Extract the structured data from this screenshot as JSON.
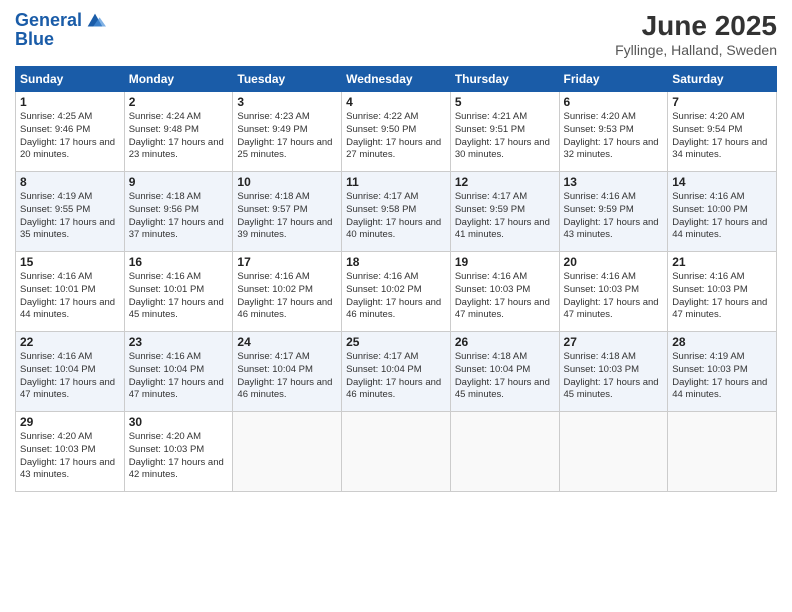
{
  "logo": {
    "line1": "General",
    "line2": "Blue"
  },
  "title": "June 2025",
  "location": "Fyllinge, Halland, Sweden",
  "days_of_week": [
    "Sunday",
    "Monday",
    "Tuesday",
    "Wednesday",
    "Thursday",
    "Friday",
    "Saturday"
  ],
  "weeks": [
    [
      {
        "day": 1,
        "sunrise": "4:25 AM",
        "sunset": "9:46 PM",
        "daylight": "17 hours and 20 minutes."
      },
      {
        "day": 2,
        "sunrise": "4:24 AM",
        "sunset": "9:48 PM",
        "daylight": "17 hours and 23 minutes."
      },
      {
        "day": 3,
        "sunrise": "4:23 AM",
        "sunset": "9:49 PM",
        "daylight": "17 hours and 25 minutes."
      },
      {
        "day": 4,
        "sunrise": "4:22 AM",
        "sunset": "9:50 PM",
        "daylight": "17 hours and 27 minutes."
      },
      {
        "day": 5,
        "sunrise": "4:21 AM",
        "sunset": "9:51 PM",
        "daylight": "17 hours and 30 minutes."
      },
      {
        "day": 6,
        "sunrise": "4:20 AM",
        "sunset": "9:53 PM",
        "daylight": "17 hours and 32 minutes."
      },
      {
        "day": 7,
        "sunrise": "4:20 AM",
        "sunset": "9:54 PM",
        "daylight": "17 hours and 34 minutes."
      }
    ],
    [
      {
        "day": 8,
        "sunrise": "4:19 AM",
        "sunset": "9:55 PM",
        "daylight": "17 hours and 35 minutes."
      },
      {
        "day": 9,
        "sunrise": "4:18 AM",
        "sunset": "9:56 PM",
        "daylight": "17 hours and 37 minutes."
      },
      {
        "day": 10,
        "sunrise": "4:18 AM",
        "sunset": "9:57 PM",
        "daylight": "17 hours and 39 minutes."
      },
      {
        "day": 11,
        "sunrise": "4:17 AM",
        "sunset": "9:58 PM",
        "daylight": "17 hours and 40 minutes."
      },
      {
        "day": 12,
        "sunrise": "4:17 AM",
        "sunset": "9:59 PM",
        "daylight": "17 hours and 41 minutes."
      },
      {
        "day": 13,
        "sunrise": "4:16 AM",
        "sunset": "9:59 PM",
        "daylight": "17 hours and 43 minutes."
      },
      {
        "day": 14,
        "sunrise": "4:16 AM",
        "sunset": "10:00 PM",
        "daylight": "17 hours and 44 minutes."
      }
    ],
    [
      {
        "day": 15,
        "sunrise": "4:16 AM",
        "sunset": "10:01 PM",
        "daylight": "17 hours and 44 minutes."
      },
      {
        "day": 16,
        "sunrise": "4:16 AM",
        "sunset": "10:01 PM",
        "daylight": "17 hours and 45 minutes."
      },
      {
        "day": 17,
        "sunrise": "4:16 AM",
        "sunset": "10:02 PM",
        "daylight": "17 hours and 46 minutes."
      },
      {
        "day": 18,
        "sunrise": "4:16 AM",
        "sunset": "10:02 PM",
        "daylight": "17 hours and 46 minutes."
      },
      {
        "day": 19,
        "sunrise": "4:16 AM",
        "sunset": "10:03 PM",
        "daylight": "17 hours and 47 minutes."
      },
      {
        "day": 20,
        "sunrise": "4:16 AM",
        "sunset": "10:03 PM",
        "daylight": "17 hours and 47 minutes."
      },
      {
        "day": 21,
        "sunrise": "4:16 AM",
        "sunset": "10:03 PM",
        "daylight": "17 hours and 47 minutes."
      }
    ],
    [
      {
        "day": 22,
        "sunrise": "4:16 AM",
        "sunset": "10:04 PM",
        "daylight": "17 hours and 47 minutes."
      },
      {
        "day": 23,
        "sunrise": "4:16 AM",
        "sunset": "10:04 PM",
        "daylight": "17 hours and 47 minutes."
      },
      {
        "day": 24,
        "sunrise": "4:17 AM",
        "sunset": "10:04 PM",
        "daylight": "17 hours and 46 minutes."
      },
      {
        "day": 25,
        "sunrise": "4:17 AM",
        "sunset": "10:04 PM",
        "daylight": "17 hours and 46 minutes."
      },
      {
        "day": 26,
        "sunrise": "4:18 AM",
        "sunset": "10:04 PM",
        "daylight": "17 hours and 45 minutes."
      },
      {
        "day": 27,
        "sunrise": "4:18 AM",
        "sunset": "10:03 PM",
        "daylight": "17 hours and 45 minutes."
      },
      {
        "day": 28,
        "sunrise": "4:19 AM",
        "sunset": "10:03 PM",
        "daylight": "17 hours and 44 minutes."
      }
    ],
    [
      {
        "day": 29,
        "sunrise": "4:20 AM",
        "sunset": "10:03 PM",
        "daylight": "17 hours and 43 minutes."
      },
      {
        "day": 30,
        "sunrise": "4:20 AM",
        "sunset": "10:03 PM",
        "daylight": "17 hours and 42 minutes."
      },
      null,
      null,
      null,
      null,
      null
    ]
  ]
}
